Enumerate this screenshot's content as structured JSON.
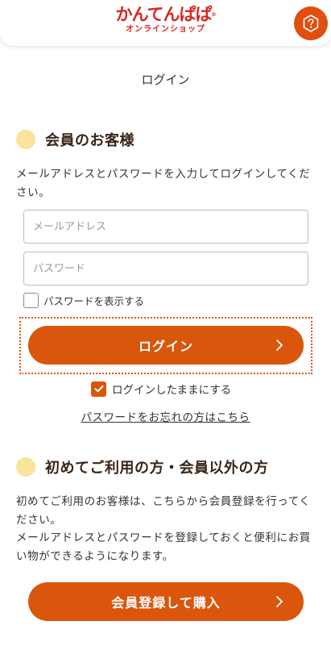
{
  "header": {
    "logo_main": "かんてんぱぱ",
    "logo_reg": "®",
    "logo_sub": "オンラインショップ",
    "help_icon": "question-hexagon-icon"
  },
  "page_title": "ログイン",
  "member_section": {
    "heading": "会員のお客様",
    "instruction": "メールアドレスとパスワードを入力してログインしてください。",
    "email_placeholder": "メールアドレス",
    "password_placeholder": "パスワード",
    "show_password_label": "パスワードを表示する",
    "login_button": "ログイン",
    "stay_logged_in_label": "ログインしたままにする",
    "stay_logged_in_checked": true,
    "forgot_password_link": "パスワードをお忘れの方はこちら"
  },
  "guest_section": {
    "heading": "初めてご利用の方・会員以外の方",
    "text_line1": "初めてご利用のお客様は、こちらから会員登録を行ってください。",
    "text_line2": "メールアドレスとパスワードを登録しておくと便利にお買い物ができるようになります。",
    "register_button": "会員登録して購入"
  },
  "colors": {
    "accent": "#d9560c",
    "brand_red": "#d7261e",
    "heading_dot": "#f8e49a"
  }
}
